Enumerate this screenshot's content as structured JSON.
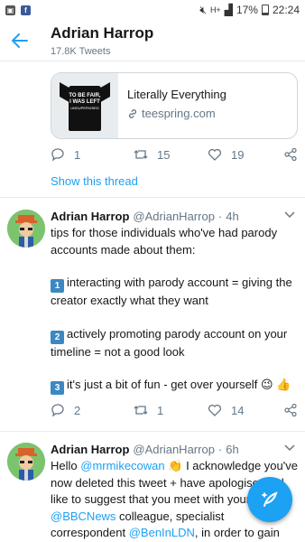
{
  "status_bar": {
    "battery": "17%",
    "time": "22:24",
    "network": "H+",
    "icons": [
      "image-notification-icon",
      "facebook-icon",
      "mute-icon",
      "wifi-icon",
      "signal-icon",
      "battery-icon"
    ]
  },
  "header": {
    "title": "Adrian Harrop",
    "subtitle": "17.8K Tweets",
    "back_icon": "back-arrow-icon"
  },
  "colors": {
    "accent": "#1da1f2",
    "secondary_text": "#657786",
    "divider": "#e6ecf0"
  },
  "card": {
    "title": "Literally Everything",
    "domain": "teespring.com",
    "image_text_line1": "TO BE FAIR,",
    "image_text_line2": "I WAS LEFT",
    "image_text_line3": "UNSUPERVISED"
  },
  "first_actions": {
    "replies": "1",
    "retweets": "15",
    "likes": "19"
  },
  "show_thread": "Show this thread",
  "tweets": [
    {
      "name": "Adrian Harrop",
      "handle": "@AdrianHarrop",
      "separator": "·",
      "time": "4h",
      "intro": "tips for those individuals who've had parody accounts made about them:",
      "tip1_num": "1",
      "tip1": "interacting with parody account = giving the creator exactly what they want",
      "tip2_num": "2",
      "tip2": "actively promoting parody account on your timeline = not a good look",
      "tip3_num": "3",
      "tip3": "it's just a bit of fun - get over yourself",
      "replies": "2",
      "retweets": "1",
      "likes": "14"
    },
    {
      "name": "Adrian Harrop",
      "handle": "@AdrianHarrop",
      "separator": "·",
      "time": "6h",
      "part1": "Hello ",
      "mention1": "@mrmikecowan",
      "part2": " I acknowledge you've now deleted this tweet + have apologised. I'd like to suggest that you meet with your ",
      "mention2": "@BBCNews",
      "part3": " colleague, specialist correspondent ",
      "mention3": "@BenInLDN",
      "part4": ", in order to gain some insight re: how harmful this"
    }
  ],
  "compose_icon": "compose-tweet-icon"
}
